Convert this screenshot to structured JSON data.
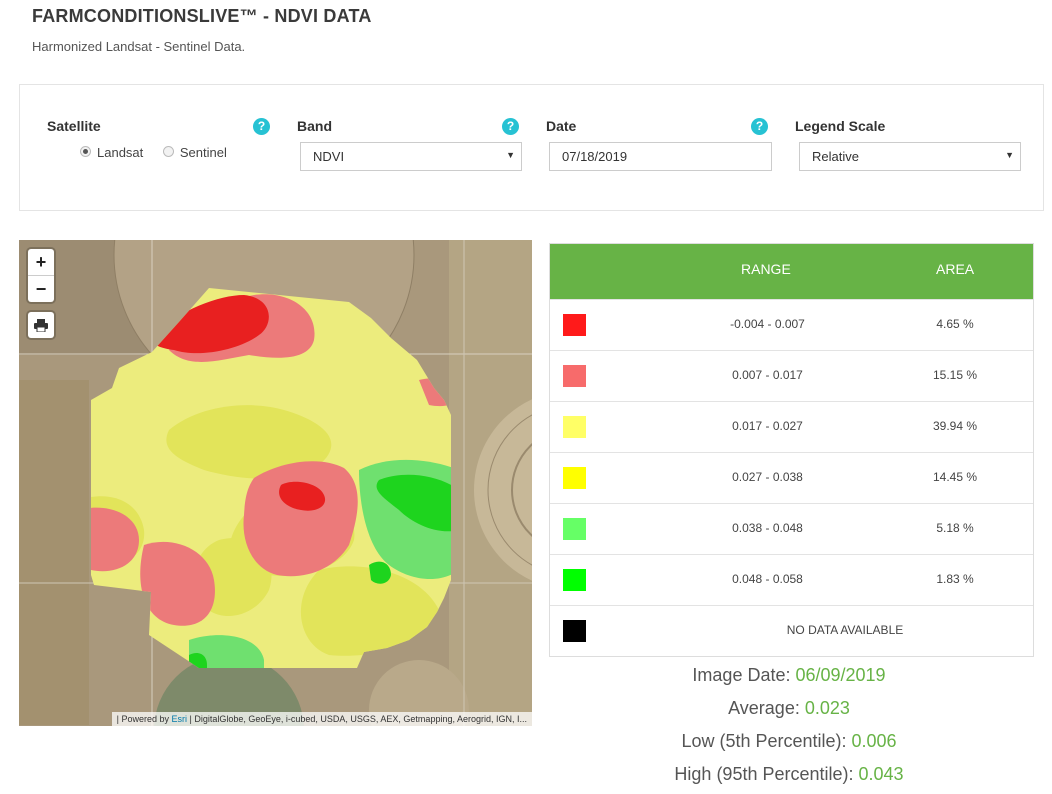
{
  "header": {
    "title": "FARMCONDITIONSLIVE™ - NDVI DATA",
    "subtitle": "Harmonized Landsat - Sentinel Data."
  },
  "form": {
    "satellite_label": "Satellite",
    "satellite_options": [
      "Landsat",
      "Sentinel"
    ],
    "satellite_selected": "Landsat",
    "band_label": "Band",
    "band_value": "NDVI",
    "date_label": "Date",
    "date_value": "07/18/2019",
    "legend_scale_label": "Legend Scale",
    "legend_scale_value": "Relative",
    "help_glyph": "?"
  },
  "map": {
    "zoom_in": "+",
    "zoom_out": "−",
    "print_icon": "printer-icon",
    "attribution_prefix": "| Powered by ",
    "attribution_esri": "Esri",
    "attribution_rest": " | DigitalGlobe, GeoEye, i-cubed, USDA, USGS, AEX, Getmapping, Aerogrid, IGN, I..."
  },
  "legend": {
    "col_range": "RANGE",
    "col_area": "AREA",
    "rows": [
      {
        "color": "#ff1a1a",
        "range": "-0.004 - 0.007",
        "area": "4.65 %"
      },
      {
        "color": "#f76b6b",
        "range": "0.007 - 0.017",
        "area": "15.15 %"
      },
      {
        "color": "#ffff66",
        "range": "0.017 - 0.027",
        "area": "39.94 %"
      },
      {
        "color": "#ffff00",
        "range": "0.027 - 0.038",
        "area": "14.45 %"
      },
      {
        "color": "#66ff66",
        "range": "0.038 - 0.048",
        "area": "5.18 %"
      },
      {
        "color": "#00ff00",
        "range": "0.048 - 0.058",
        "area": "1.83 %"
      }
    ],
    "nodata_color": "#000000",
    "nodata_label": "NO DATA AVAILABLE"
  },
  "stats": {
    "image_date_label": "Image Date: ",
    "image_date": "06/09/2019",
    "average_label": "Average: ",
    "average": "0.023",
    "low_label": "Low (5th Percentile): ",
    "low": "0.006",
    "high_label": "High (95th Percentile): ",
    "high": "0.043"
  },
  "colors": {
    "accent_green": "#67b346",
    "help_cyan": "#27c2d3"
  }
}
